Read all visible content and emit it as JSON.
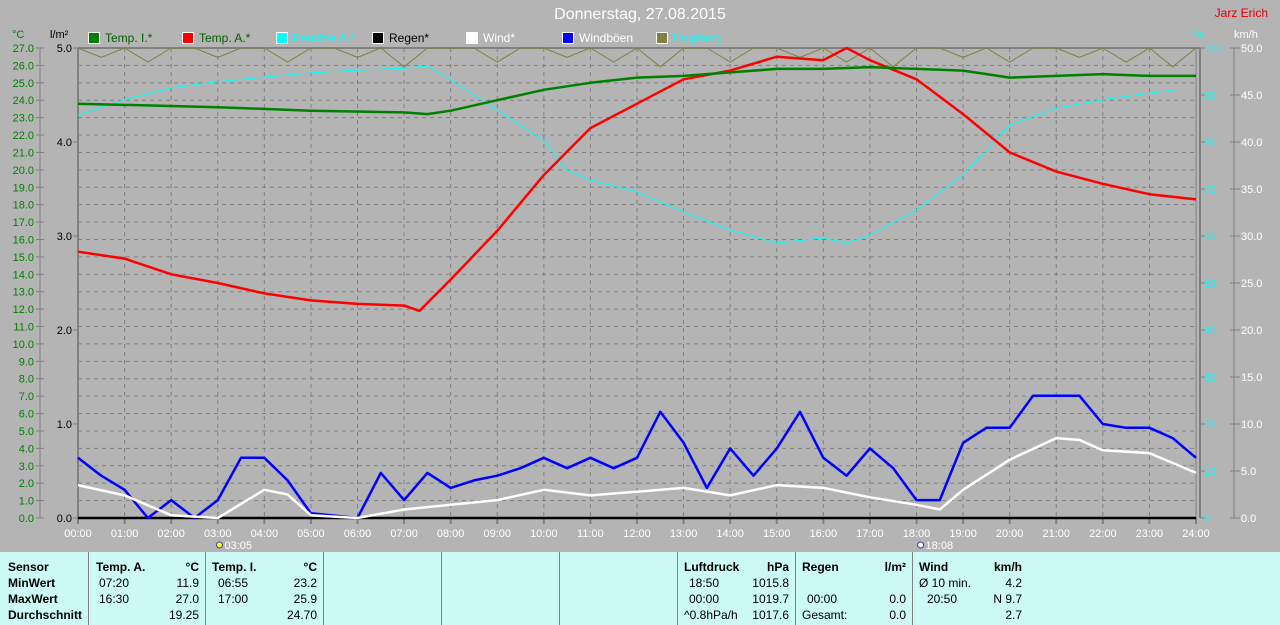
{
  "title": "Donnerstag, 27.08.2015",
  "owner": "Jarz Erich",
  "legend": [
    {
      "label": "Temp. I.*",
      "color": "#008000",
      "text_color": "#006000"
    },
    {
      "label": "Temp. A.*",
      "color": "#ff0000",
      "text_color": "#006000"
    },
    {
      "label": "Feuchte A.*",
      "color": "#00ffff",
      "text_color": "#00ffff"
    },
    {
      "label": "Regen*",
      "color": "#000000",
      "text_color": "#000000"
    },
    {
      "label": "Wind*",
      "color": "#ffffff",
      "text_color": "#ffffff"
    },
    {
      "label": "Windböen",
      "color": "#0000ff",
      "text_color": "#ffffff"
    },
    {
      "label": "Empfang",
      "color": "#808040",
      "text_color": "#00ffff"
    }
  ],
  "chart_data": {
    "type": "line",
    "x_ticks": [
      "00:00",
      "01:00",
      "02:00",
      "03:00",
      "04:00",
      "05:00",
      "06:00",
      "07:00",
      "08:00",
      "09:00",
      "10:00",
      "11:00",
      "12:00",
      "13:00",
      "14:00",
      "15:00",
      "16:00",
      "17:00",
      "18:00",
      "19:00",
      "20:00",
      "21:00",
      "22:00",
      "23:00",
      "24:00"
    ],
    "axes": {
      "temp": {
        "unit": "°C",
        "range": [
          0,
          27
        ],
        "color": "#008000"
      },
      "rain": {
        "unit": "l/m²",
        "range": [
          0,
          5
        ],
        "ticks": [
          "0.0",
          "1.0",
          "2.0",
          "3.0",
          "4.0",
          "5.0"
        ],
        "color": "#000000"
      },
      "humidity": {
        "unit": "%",
        "range": [
          0,
          100
        ],
        "ticks": [
          "0",
          "10",
          "20",
          "30",
          "40",
          "50",
          "60",
          "70",
          "80",
          "90",
          "100"
        ],
        "color": "#00ffff"
      },
      "wind": {
        "unit": "km/h",
        "range": [
          0,
          50
        ],
        "ticks": [
          "0.0",
          "5.0",
          "10.0",
          "15.0",
          "20.0",
          "25.0",
          "30.0",
          "35.0",
          "40.0",
          "45.0",
          "50.0"
        ],
        "color": "#ffffff"
      }
    },
    "grid": true,
    "sun_markers": [
      {
        "label": "03:05",
        "time": 3.08,
        "kind": "sunrise"
      },
      {
        "label": "18:08",
        "time": 18.13,
        "kind": "sunset"
      }
    ],
    "series": [
      {
        "name": "Temp. I.*",
        "axis": "temp",
        "color": "#008000",
        "x": [
          0,
          3,
          5,
          7,
          7.5,
          8,
          9,
          10,
          11,
          12,
          13,
          14,
          15,
          16,
          17,
          18,
          19,
          20,
          21,
          22,
          23,
          24
        ],
        "y": [
          23.8,
          23.6,
          23.4,
          23.3,
          23.2,
          23.4,
          24.0,
          24.6,
          25.0,
          25.3,
          25.4,
          25.6,
          25.8,
          25.8,
          25.9,
          25.8,
          25.7,
          25.3,
          25.4,
          25.5,
          25.4,
          25.4
        ]
      },
      {
        "name": "Temp. A.*",
        "axis": "temp",
        "color": "#ff0000",
        "x": [
          0,
          1,
          2,
          3,
          4,
          5,
          6,
          7,
          7.33,
          8,
          9,
          10,
          11,
          12,
          13,
          14,
          15,
          16,
          16.5,
          17,
          18,
          19,
          20,
          21,
          22,
          23,
          24
        ],
        "y": [
          15.3,
          14.9,
          14.0,
          13.5,
          12.9,
          12.5,
          12.3,
          12.2,
          11.9,
          13.7,
          16.5,
          19.7,
          22.4,
          23.8,
          25.2,
          25.7,
          26.5,
          26.3,
          27.0,
          26.3,
          25.2,
          23.2,
          21.0,
          19.9,
          19.2,
          18.6,
          18.3
        ]
      },
      {
        "name": "Feuchte A.*",
        "axis": "humidity",
        "color": "#00ffff",
        "x": [
          0,
          1,
          2,
          3,
          4,
          5,
          6,
          7,
          7.5,
          8,
          9,
          10,
          10.5,
          11,
          12,
          13,
          14,
          15,
          16,
          16.5,
          17,
          18,
          19,
          20,
          21,
          22,
          23,
          23.5
        ],
        "y": [
          85.7,
          89,
          91.5,
          92.8,
          93.8,
          94.7,
          95.3,
          95.7,
          96.2,
          93.2,
          86.8,
          80.4,
          74,
          71.9,
          69.4,
          65.1,
          61.3,
          58.5,
          59.6,
          58.5,
          60.2,
          65.5,
          73,
          83.6,
          87.2,
          89,
          90.4,
          91
        ]
      },
      {
        "name": "Regen*",
        "axis": "rain",
        "color": "#000000",
        "x": [
          0,
          24
        ],
        "y": [
          0,
          0
        ]
      },
      {
        "name": "Wind*",
        "axis": "wind",
        "color": "#ffffff",
        "x": [
          0,
          1,
          2,
          3,
          4,
          4.5,
          5,
          6,
          7,
          8,
          9,
          10,
          11,
          12,
          13,
          14,
          15,
          16,
          17,
          18,
          18.5,
          19,
          20,
          21,
          21.5,
          22,
          23,
          24
        ],
        "y": [
          3.5,
          2.4,
          0.3,
          0,
          3,
          2.5,
          0.3,
          0,
          0.9,
          1.4,
          1.9,
          3,
          2.4,
          2.8,
          3.2,
          2.4,
          3.5,
          3.2,
          2.2,
          1.4,
          0.9,
          3,
          6.2,
          8.5,
          8.3,
          7.2,
          6.9,
          4.8
        ]
      },
      {
        "name": "Windböen",
        "axis": "wind",
        "color": "#0000ff",
        "x": [
          0,
          0.5,
          1,
          1.5,
          2,
          2.5,
          3,
          3.5,
          4,
          4.5,
          5,
          6,
          6.5,
          7,
          7.5,
          8,
          8.5,
          9,
          9.5,
          10,
          10.5,
          11,
          11.5,
          12,
          12.5,
          13,
          13.5,
          14,
          14.5,
          15,
          15.5,
          16,
          16.5,
          17,
          17.5,
          18,
          18.5,
          19,
          19.5,
          20,
          20.5,
          21,
          21.5,
          22,
          22.5,
          23,
          23.5,
          24
        ],
        "y": [
          6.4,
          4.5,
          3,
          0,
          1.9,
          0,
          1.9,
          6.4,
          6.4,
          4,
          0.5,
          0,
          4.8,
          1.9,
          4.8,
          3.2,
          4,
          4.5,
          5.3,
          6.4,
          5.3,
          6.4,
          5.3,
          6.4,
          11.3,
          8,
          3.2,
          7.4,
          4.5,
          7.4,
          11.3,
          6.4,
          4.5,
          7.4,
          5.3,
          1.9,
          1.9,
          8,
          9.6,
          9.6,
          13,
          13,
          13,
          10,
          9.6,
          9.6,
          8.5,
          6.4
        ]
      },
      {
        "name": "Empfang",
        "axis": "humidity",
        "color": "#808040",
        "x": [
          0,
          0.5,
          1,
          1.5,
          2,
          2.5,
          3,
          3.5,
          4,
          4.5,
          5,
          5.5,
          6,
          6.5,
          7,
          7.5,
          8,
          8.5,
          9,
          9.5,
          10,
          10.5,
          11,
          11.5,
          12,
          12.5,
          13,
          13.5,
          14,
          14.5,
          15,
          15.5,
          16,
          16.5,
          17,
          17.5,
          18,
          18.5,
          19,
          19.5,
          20,
          20.5,
          21,
          21.5,
          22,
          22.5,
          23,
          23.5,
          24
        ],
        "y": [
          100,
          98,
          100,
          97,
          100,
          100,
          98,
          100,
          100,
          97,
          100,
          100,
          98,
          100,
          96,
          100,
          100,
          100,
          97,
          100,
          100,
          98,
          100,
          97,
          100,
          96,
          100,
          100,
          97,
          100,
          100,
          98,
          100,
          97,
          100,
          96,
          100,
          100,
          98,
          100,
          97,
          100,
          100,
          98,
          100,
          97,
          100,
          96,
          100
        ]
      }
    ]
  },
  "stats": {
    "sensor": {
      "header": "Sensor",
      "rows": [
        "MinWert",
        "MaxWert",
        "Durchschnitt"
      ]
    },
    "temp_a": {
      "header": "Temp. A.",
      "unit": "°C",
      "min_time": "07:20",
      "min": "11.9",
      "max_time": "16:30",
      "max": "27.0",
      "avg": "19.25"
    },
    "temp_i": {
      "header": "Temp. I.",
      "unit": "°C",
      "min_time": "06:55",
      "min": "23.2",
      "max_time": "17:00",
      "max": "25.9",
      "avg": "24.70"
    },
    "pressure": {
      "header": "Luftdruck",
      "unit": "hPa",
      "r1_label": "18:50",
      "r1": "1015.8",
      "r2_label": "00:00",
      "r2": "1019.7",
      "r3_label": "^0.8hPa/h",
      "r3": "1017.6"
    },
    "rain": {
      "header": "Regen",
      "unit": "l/m²",
      "r2_label": "00:00",
      "r2": "0.0",
      "r3_label": "Gesamt:",
      "r3": "0.0"
    },
    "wind": {
      "header": "Wind",
      "unit": "km/h",
      "r1_label": "Ø 10 min.",
      "r1": "4.2",
      "r2_label": "20:50",
      "r2": "N 9.7",
      "r3": "2.7"
    }
  }
}
